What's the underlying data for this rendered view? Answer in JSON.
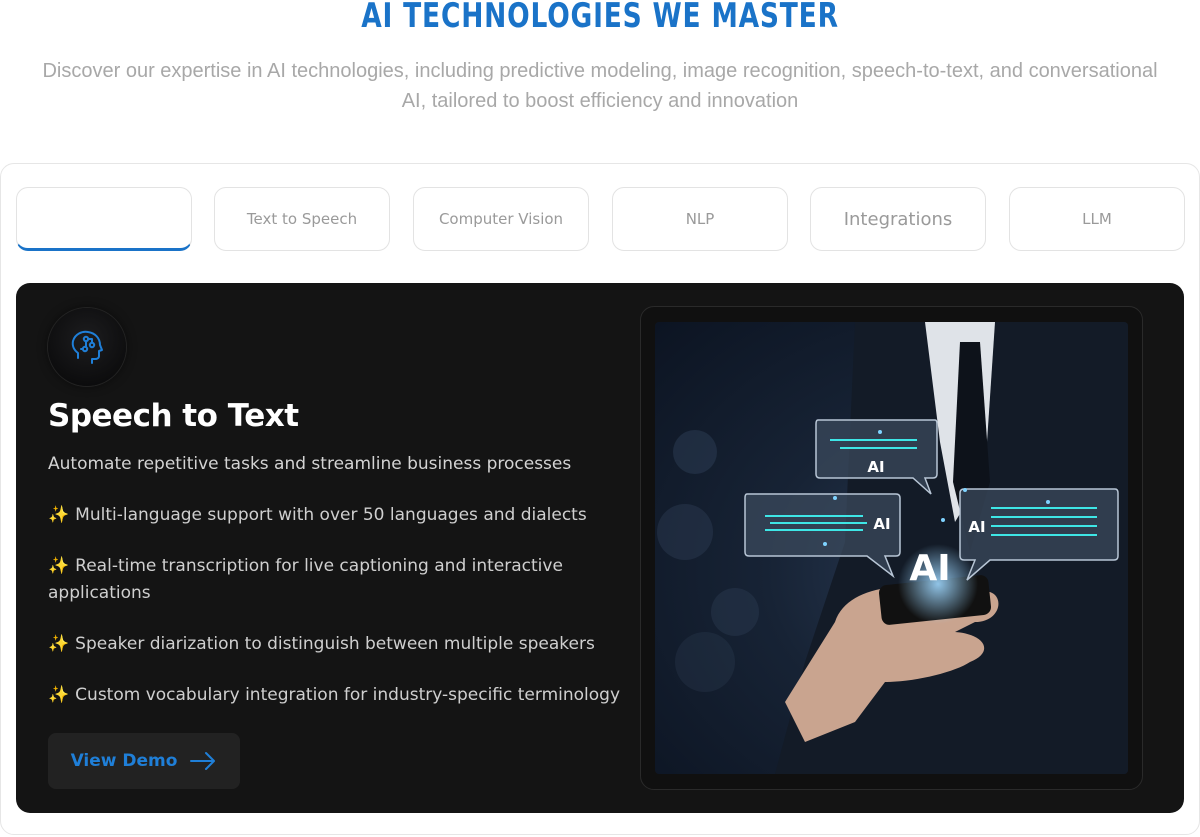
{
  "header": {
    "title": "AI TECHNOLOGIES WE MASTER",
    "subtitle_line1": "Discover our expertise in AI technologies, including predictive modeling, image recognition, speech-to-text, and conversational",
    "subtitle_line2": "AI, tailored to boost efficiency and innovation"
  },
  "tabs": [
    {
      "label": "",
      "active": true
    },
    {
      "label": "Text to Speech"
    },
    {
      "label": "Computer Vision"
    },
    {
      "label": "NLP"
    },
    {
      "label": "Integrations"
    },
    {
      "label": "LLM"
    }
  ],
  "panel": {
    "icon": "ai-head-icon",
    "title": "Speech to Text",
    "description": "Automate repetitive tasks and streamline business processes",
    "spark_icon": "✨",
    "features": [
      "Multi-language support with over 50 languages and dialects",
      "Real-time transcription for live captioning and interactive applications",
      "Speaker diarization to distinguish between multiple speakers",
      "Custom vocabulary integration for industry-specific terminology"
    ],
    "button_label": "View Demo",
    "button_icon": "arrow-right-icon",
    "image": {
      "bubble_top_label": "AI",
      "bubble_left_label": "AI",
      "bubble_right_label": "AI",
      "center_label": "AI"
    }
  },
  "colors": {
    "accent": "#1a73c8",
    "panel_bg": "#141414",
    "button_text": "#1f7fd8"
  }
}
